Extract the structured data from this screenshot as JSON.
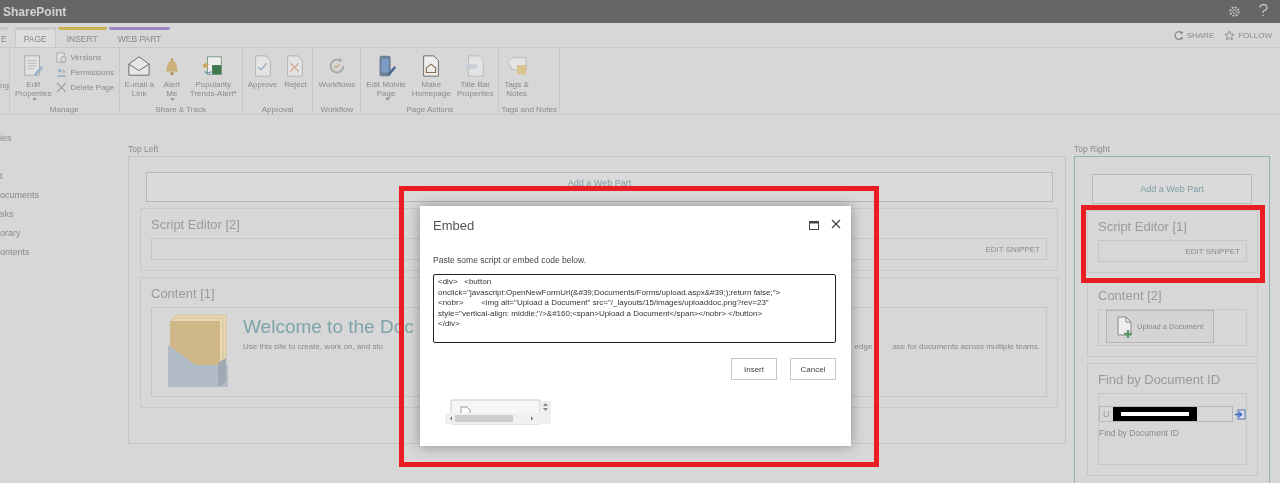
{
  "top_bar": {
    "title": "SharePoint"
  },
  "ribbon_tabs": [
    {
      "label": "E",
      "selected": false,
      "color": "#c8c8c8"
    },
    {
      "label": "PAGE",
      "selected": true,
      "color": "#c8c8c8"
    },
    {
      "label": "INSERT",
      "selected": false,
      "color": "#c9b24f"
    },
    {
      "label": "WEB PART",
      "selected": false,
      "color": "#9f83c4"
    }
  ],
  "ribbon_actions": [
    {
      "label": "SHARE"
    },
    {
      "label": "FOLLOW"
    }
  ],
  "ribbon_cut_label": "ng",
  "ribbon_groups": [
    {
      "title": "Manage",
      "items": [
        {
          "kind": "large",
          "lines": [
            "Edit",
            "Properties"
          ],
          "dropdown": true
        },
        {
          "kind": "small",
          "lines": [
            "Versions"
          ],
          "dropdown": false
        },
        {
          "kind": "small",
          "lines": [
            "Permissions"
          ],
          "dropdown": false
        },
        {
          "kind": "small",
          "lines": [
            "Delete Page"
          ],
          "dropdown": false
        }
      ]
    },
    {
      "title": "Share & Track",
      "items": [
        {
          "kind": "large",
          "lines": [
            "E-mail a",
            "Link"
          ],
          "dropdown": false
        },
        {
          "kind": "large",
          "lines": [
            "Alert",
            "Me"
          ],
          "dropdown": true
        },
        {
          "kind": "large",
          "lines": [
            "Popularity",
            "Trends-Alert*"
          ],
          "dropdown": false
        }
      ]
    },
    {
      "title": "Approval",
      "items": [
        {
          "kind": "large",
          "lines": [
            "Approve"
          ],
          "dropdown": false
        },
        {
          "kind": "large",
          "lines": [
            "Reject"
          ],
          "dropdown": false
        }
      ]
    },
    {
      "title": "Workflow",
      "items": [
        {
          "kind": "large",
          "lines": [
            "Workflows"
          ],
          "dropdown": false
        }
      ]
    },
    {
      "title": "Page Actions",
      "items": [
        {
          "kind": "large",
          "lines": [
            "Edit Mobile",
            "Page"
          ],
          "dropdown": true
        },
        {
          "kind": "large",
          "lines": [
            "Make",
            "Homepage"
          ],
          "dropdown": false
        },
        {
          "kind": "large",
          "lines": [
            "Title Bar",
            "Properties"
          ],
          "dropdown": false
        }
      ]
    },
    {
      "title": "Tags and Notes",
      "items": [
        {
          "kind": "large",
          "lines": [
            "Tags &",
            "Notes"
          ],
          "dropdown": false
        }
      ]
    }
  ],
  "left_nav": [
    "ies",
    "t",
    "ocuments",
    "sks",
    "orary",
    "ontents"
  ],
  "top_left": {
    "label": "Top Left",
    "add_web_part": "Add a Web Part",
    "script_editor": {
      "title": "Script Editor [2]",
      "action": "EDIT SNIPPET"
    },
    "content": {
      "title": "Content [1]",
      "heading": "Welcome to the Doc",
      "text_left": "Use this site to create, work on, and sto",
      "text_mid": "edge",
      "text_right": "ase for documents across multiple teams."
    }
  },
  "top_right": {
    "label": "Top Right",
    "add_web_part": "Add a Web Part",
    "script_editor": {
      "title": "Script Editor [1]",
      "action": "EDIT SNIPPET"
    },
    "content": {
      "title": "Content [2]",
      "button": "Upload a Document"
    },
    "find": {
      "title": "Find by Document ID",
      "value": "U",
      "caption": "Find by Document ID"
    }
  },
  "dialog": {
    "title": "Embed",
    "instruction": "Paste some script or embed code below.",
    "code": "<div>   <button\nonclick=\"javascript:OpenNewFormUrl(&#39;Documents/Forms/upload.aspx&#39;);return false;\">\n<nobr>        <img alt=\"Upload a Document\" src=\"/_layouts/15/images/uploaddoc.png?rev=23\"\nstyle=\"vertical-align: middle;\"/>&#160;<span>Upload a Document</span></nobr> </button>\n</div>",
    "buttons": [
      "Insert",
      "Cancel"
    ]
  }
}
